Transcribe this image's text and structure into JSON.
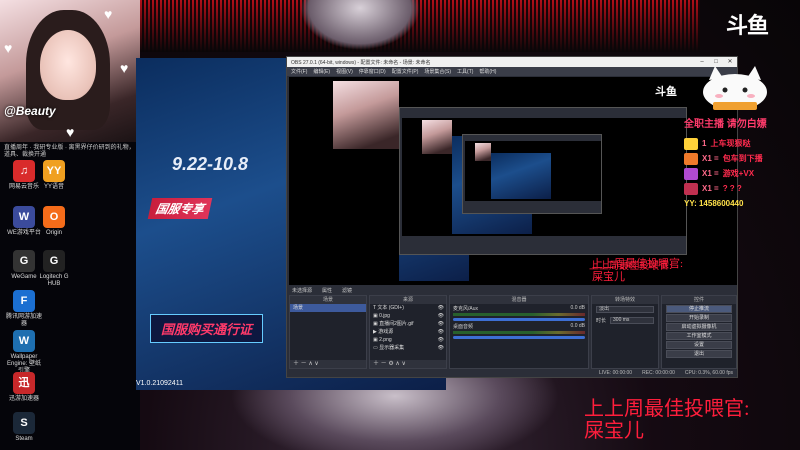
{
  "top": {
    "logo": "斗鱼"
  },
  "webcam": {
    "label": "@Beauty"
  },
  "desktop": {
    "info_text": "直播周年 · 我研专业版 · 离黑界仔价研到的礼物，道具、裁换开通",
    "icons": [
      {
        "label": "网易云音乐",
        "color": "#d92b2b",
        "glyph": "♫"
      },
      {
        "label": "YY语音",
        "color": "#f0a020",
        "glyph": "YY"
      },
      {
        "label": "WE游戏平台",
        "color": "#3b4b9c",
        "glyph": "W"
      },
      {
        "label": "Origin",
        "color": "#f56c1a",
        "glyph": "O"
      },
      {
        "label": "WeGame",
        "color": "#333333",
        "glyph": "G"
      },
      {
        "label": "Logitech G HUB",
        "color": "#222222",
        "glyph": "G"
      },
      {
        "label": "腾讯网游加速器",
        "color": "#1b6fd1",
        "glyph": "F"
      },
      {
        "label": "Wallpaper Engine: 壁纸引擎",
        "color": "#1e6fb0",
        "glyph": "W"
      },
      {
        "label": "迅游加速器",
        "color": "#c7282a",
        "glyph": "迅"
      },
      {
        "label": "Steam",
        "color": "#1b2838",
        "glyph": "S"
      }
    ]
  },
  "poster": {
    "date": "9.22-10.8",
    "badge": "国服专享",
    "banner": "国服购买通行证",
    "version": "V1.0.21092411"
  },
  "obs": {
    "title": "OBS 27.0.1 (64-bit, windows) - 配置文件: 未命名 - 场景: 未命名",
    "menu": [
      "文件(F)",
      "编辑(E)",
      "视图(V)",
      "停靠窗口(D)",
      "配置文件(P)",
      "场景集合(S)",
      "工具(T)",
      "帮助(H)"
    ],
    "docks_head": [
      "未选择源",
      "属性",
      "滤镜"
    ],
    "scenes": {
      "title": "场景",
      "items": [
        "场景"
      ]
    },
    "sources": {
      "title": "来源",
      "items": [
        "文本 (GDI+)",
        "0.jpg",
        "直播间2图片.gif",
        "游戏源",
        "2.png",
        "显示器采集"
      ]
    },
    "mixer": {
      "title": "混音器",
      "tracks": [
        {
          "name": "麦克风/Aux",
          "db": "0.0 dB"
        },
        {
          "name": "桌面音频",
          "db": "0.0 dB"
        }
      ]
    },
    "transitions": {
      "title": "转场特效",
      "type": "淡出",
      "duration_label": "时长",
      "duration": "300 ms"
    },
    "controls": {
      "title": "控件",
      "buttons": [
        "停止推流",
        "开始录制",
        "启动虚拟摄像机",
        "工作室模式",
        "设置",
        "退出"
      ]
    },
    "status": {
      "live": "LIVE: 00:00:00",
      "rec": "REC: 00:00:00",
      "cpu": "CPU: 0.3%, 60.00 fps"
    }
  },
  "right_panel": {
    "head": "全职主播 请勿白嫖",
    "rows": [
      {
        "label": "1",
        "text": "上车现狠哒",
        "color": "#ffd23a"
      },
      {
        "label": "X1 =",
        "text": "包车到下播",
        "color": "#f07a2a"
      },
      {
        "label": "X1 =",
        "text": "游戏+VX",
        "color": "#b04ad0"
      },
      {
        "label": "X1 =",
        "text": "? ? ?",
        "color": "#c03050"
      }
    ],
    "yy": "YY: 1458600440"
  },
  "overlay": {
    "line1": "上上周最佳投喂官:",
    "line2": "屎宝儿"
  }
}
